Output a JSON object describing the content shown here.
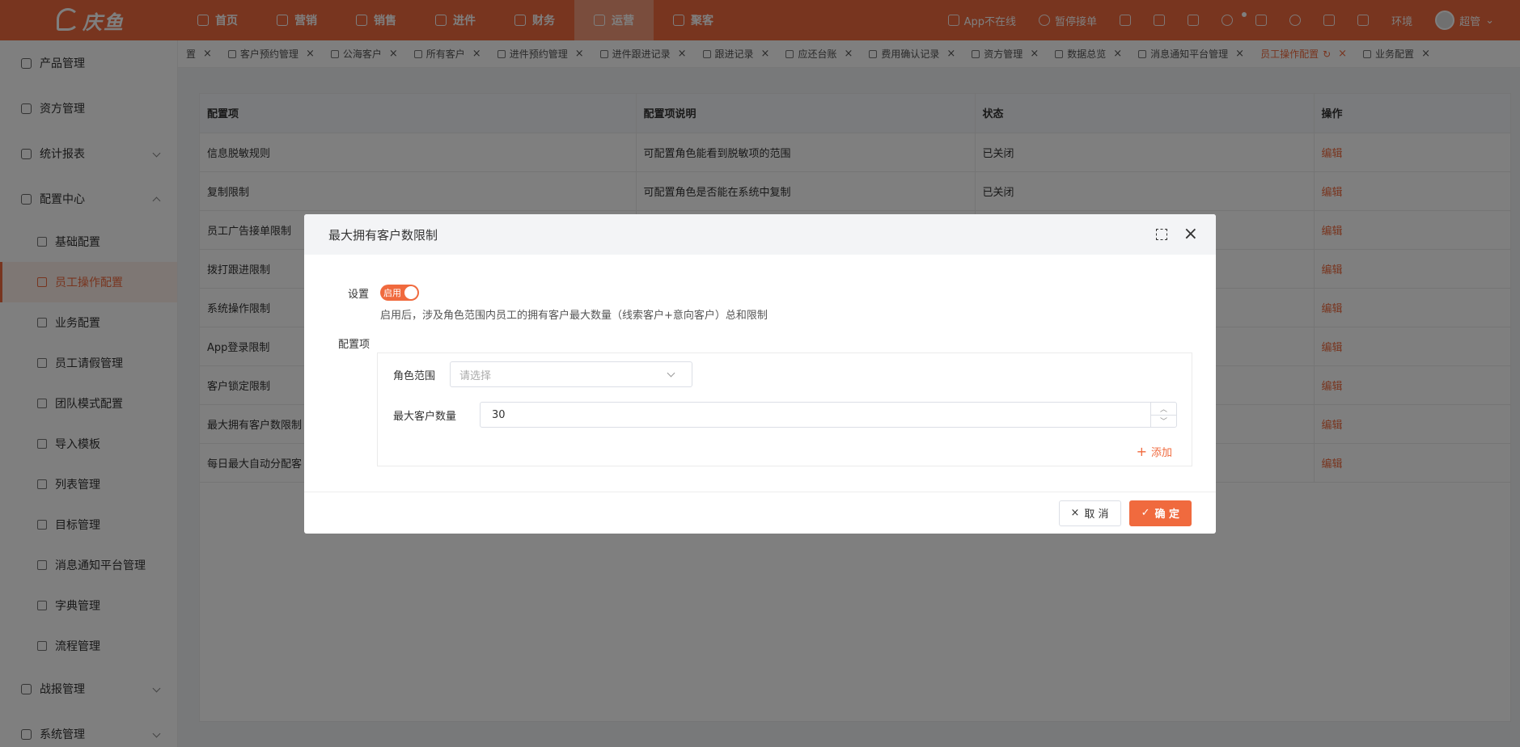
{
  "brand": {
    "name": "庆鱼"
  },
  "nav": {
    "items": [
      {
        "label": "首页",
        "icon": "home-icon"
      },
      {
        "label": "营销",
        "icon": "marketing-icon"
      },
      {
        "label": "销售",
        "icon": "sales-icon"
      },
      {
        "label": "进件",
        "icon": "document-icon"
      },
      {
        "label": "财务",
        "icon": "finance-icon"
      },
      {
        "label": "运营",
        "icon": "operations-icon",
        "active": true
      },
      {
        "label": "聚客",
        "icon": "customers-icon"
      }
    ],
    "app_status": "App不在线",
    "pause_orders": "暂停接单",
    "env": "环境",
    "user": "超管"
  },
  "sidebar": {
    "items": [
      {
        "label": "产品管理"
      },
      {
        "label": "资方管理"
      },
      {
        "label": "统计报表"
      },
      {
        "label": "配置中心"
      }
    ],
    "sub_items": [
      {
        "label": "基础配置"
      },
      {
        "label": "员工操作配置",
        "active": true
      },
      {
        "label": "业务配置"
      },
      {
        "label": "员工请假管理"
      },
      {
        "label": "团队模式配置"
      },
      {
        "label": "导入模板"
      },
      {
        "label": "列表管理"
      },
      {
        "label": "目标管理"
      },
      {
        "label": "消息通知平台管理"
      },
      {
        "label": "字典管理"
      },
      {
        "label": "流程管理"
      }
    ],
    "bottom_items": [
      {
        "label": "战报管理"
      },
      {
        "label": "系统管理"
      }
    ]
  },
  "tabs": [
    {
      "label": "置"
    },
    {
      "label": "客户预约管理"
    },
    {
      "label": "公海客户"
    },
    {
      "label": "所有客户"
    },
    {
      "label": "进件预约管理"
    },
    {
      "label": "进件跟进记录"
    },
    {
      "label": "跟进记录"
    },
    {
      "label": "应还台账"
    },
    {
      "label": "费用确认记录"
    },
    {
      "label": "资方管理"
    },
    {
      "label": "数据总览"
    },
    {
      "label": "消息通知平台管理"
    },
    {
      "label": "员工操作配置",
      "active": true
    },
    {
      "label": "业务配置"
    }
  ],
  "table": {
    "headers": [
      "配置项",
      "配置项说明",
      "状态",
      "操作"
    ],
    "rows": [
      {
        "name": "信息脱敏规则",
        "desc": "可配置角色能看到脱敏项的范围",
        "status": "已关闭",
        "action": "编辑"
      },
      {
        "name": "复制限制",
        "desc": "可配置角色是否能在系统中复制",
        "status": "已关闭",
        "action": "编辑"
      },
      {
        "name": "员工广告接单限制",
        "desc": "",
        "status": "",
        "action": "编辑"
      },
      {
        "name": "拨打跟进限制",
        "desc": "",
        "status": "",
        "action": "编辑"
      },
      {
        "name": "系统操作限制",
        "desc": "",
        "status": "",
        "action": "编辑"
      },
      {
        "name": "App登录限制",
        "desc": "",
        "status": "",
        "action": "编辑"
      },
      {
        "name": "客户锁定限制",
        "desc": "",
        "status": "",
        "action": "编辑"
      },
      {
        "name": "最大拥有客户数限制",
        "desc": "",
        "status": "",
        "action": "编辑"
      },
      {
        "name": "每日最大自动分配客",
        "desc": "",
        "status": "",
        "action": "编辑"
      }
    ]
  },
  "modal": {
    "title": "最大拥有客户数限制",
    "setting_label": "设置",
    "switch_text": "启用",
    "hint": "启用后，涉及角色范围内员工的拥有客户最大数量（线索客户+意向客户）总和限制",
    "config_label": "配置项",
    "role_label": "角色范围",
    "role_placeholder": "请选择",
    "max_label": "最大客户数量",
    "max_value": "30",
    "add_label": "添加",
    "cancel_label": "取 消",
    "ok_label": "确 定"
  }
}
